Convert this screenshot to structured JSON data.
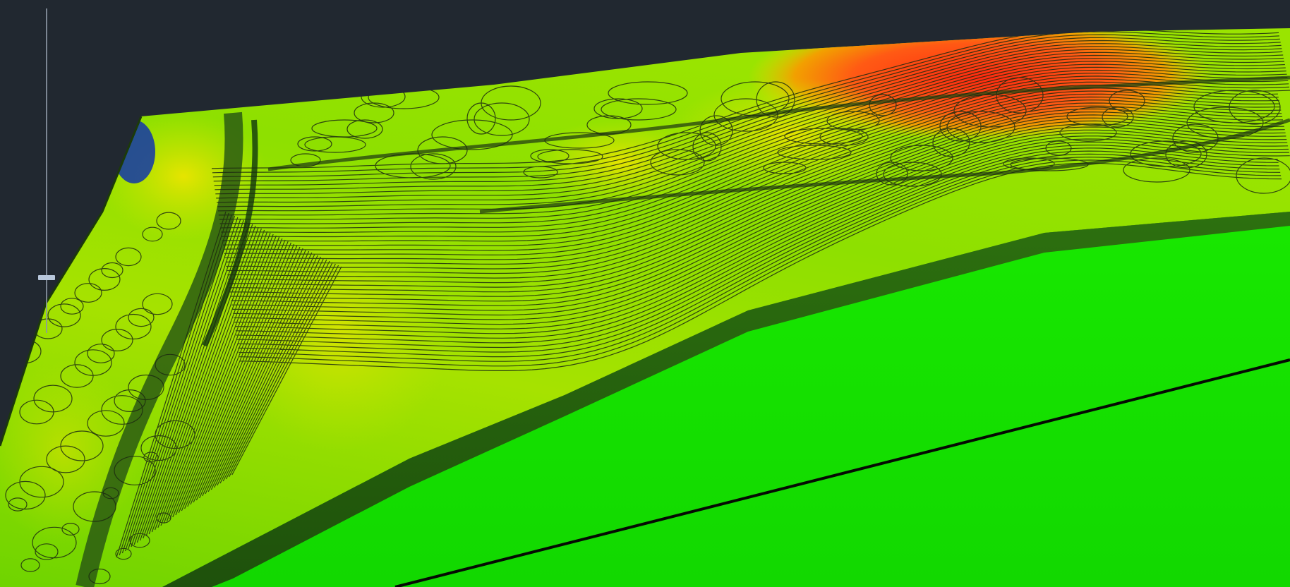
{
  "viewer": {
    "background_color": "#212830",
    "colormap": [
      "#0a3fa6",
      "#12e000",
      "#7ee000",
      "#a8e400",
      "#e8e800",
      "#f2a600",
      "#ff4a12",
      "#e81410"
    ],
    "contour_line_color": "#1c2a10",
    "base_plate_color": "#14e600",
    "edge_line_color": "#000000"
  },
  "elevation_slider": {
    "track_color": "#8c96a4",
    "handle_color": "#b9c8dc",
    "value": 0.0
  },
  "icons": {
    "slider_handle": "slider-handle-icon"
  }
}
